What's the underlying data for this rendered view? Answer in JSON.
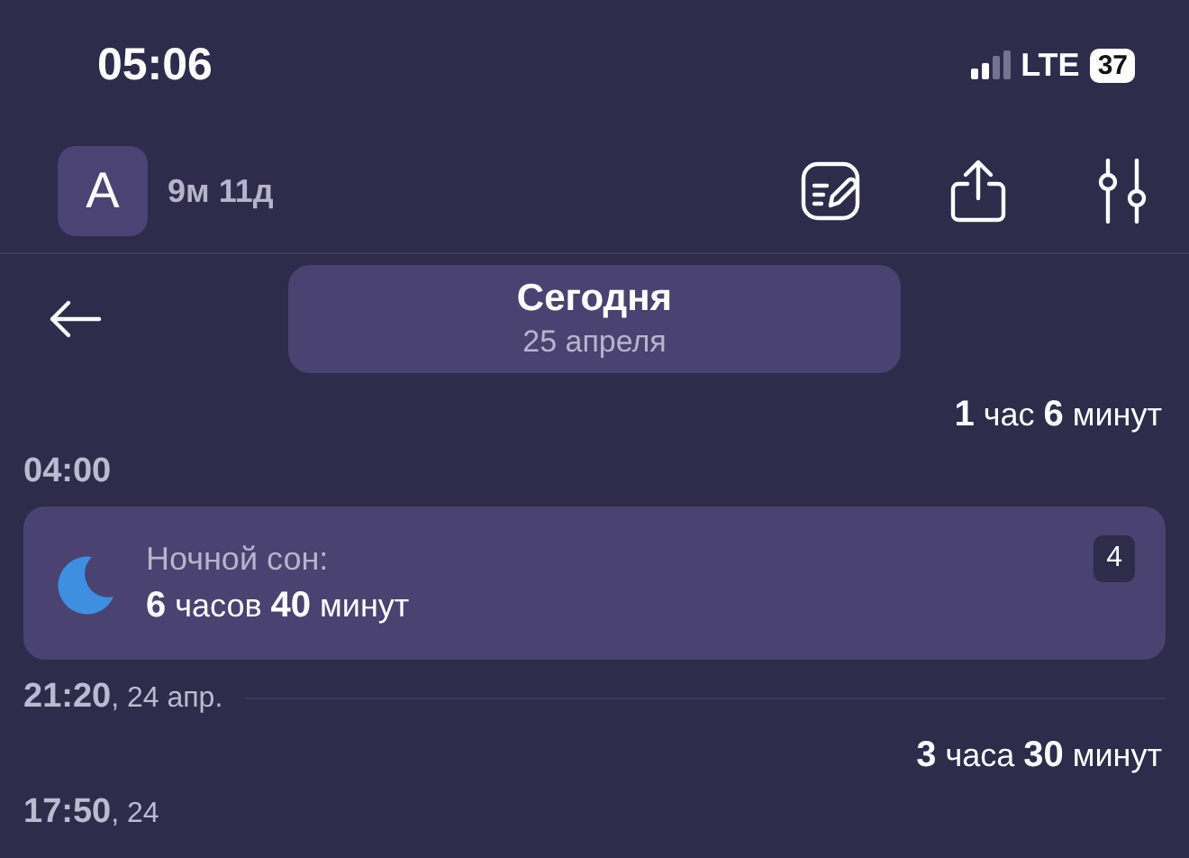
{
  "status_bar": {
    "time": "05:06",
    "network": "LTE",
    "battery": "37"
  },
  "header": {
    "avatar_letter": "A",
    "age": "9м 11д"
  },
  "date_pill": {
    "title": "Сегодня",
    "subtitle": "25 апреля"
  },
  "timeline": [
    {
      "kind": "duration",
      "text": "**1** час **6** минут"
    },
    {
      "kind": "time",
      "time": "04:00",
      "divider": false
    },
    {
      "kind": "event",
      "label": "Ночной сон:",
      "value": "**6** часов **40** минут",
      "badge": "4"
    },
    {
      "kind": "time",
      "time": "21:20",
      "date": ", 24 апр.",
      "divider": true
    },
    {
      "kind": "duration",
      "text": "**3** часа **30** минут"
    },
    {
      "kind": "time",
      "time": "17:50",
      "date": ", 24",
      "divider": false
    }
  ]
}
